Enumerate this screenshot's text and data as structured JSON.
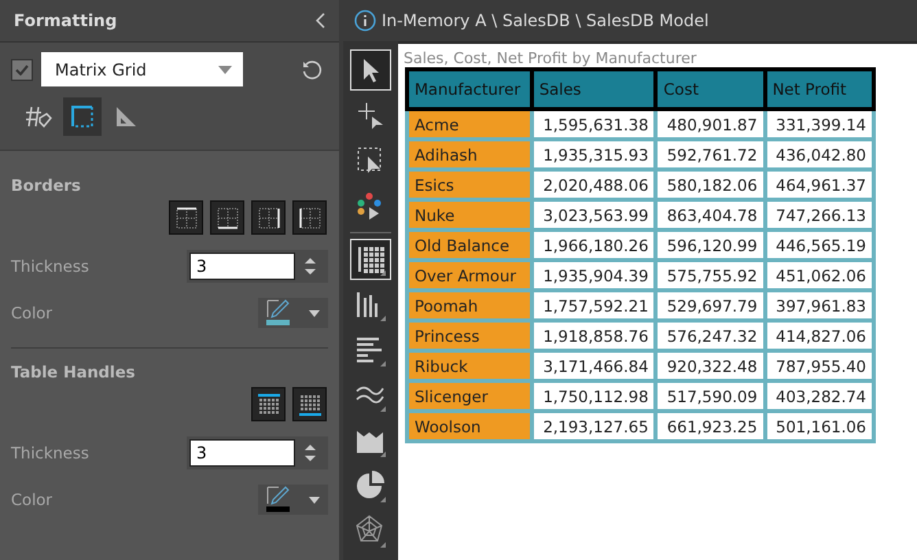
{
  "panel": {
    "title": "Formatting",
    "visual": {
      "checked": true,
      "value": "Matrix Grid"
    },
    "tabs": [
      {
        "kind": "format",
        "selected": false
      },
      {
        "kind": "borders",
        "selected": true
      },
      {
        "kind": "measure",
        "selected": false
      }
    ],
    "sections": [
      {
        "heading": "Borders",
        "options": [
          {
            "kind": "top",
            "selected": false
          },
          {
            "kind": "bottom",
            "selected": false
          },
          {
            "kind": "right",
            "selected": false
          },
          {
            "kind": "left",
            "selected": false
          }
        ],
        "thickness_label": "Thickness",
        "thickness": "3",
        "color_label": "Color",
        "color": "#5fb3c2"
      },
      {
        "heading": "Table Handles",
        "options": [
          {
            "kind": "top-handle",
            "selected": false
          },
          {
            "kind": "bottom-handle",
            "selected": false
          }
        ],
        "thickness_label": "Thickness",
        "thickness": "3",
        "color_label": "Color",
        "color": "#000000"
      }
    ]
  },
  "breadcrumb": "In-Memory A \\ SalesDB \\ SalesDB Model",
  "tools": [
    {
      "kind": "pointer",
      "selected": true
    },
    {
      "kind": "add",
      "selected": false
    },
    {
      "kind": "select",
      "selected": false
    },
    {
      "kind": "scatter",
      "selected": false
    },
    {
      "kind": "grid",
      "selected": true
    },
    {
      "kind": "columns",
      "selected": false
    },
    {
      "kind": "bars",
      "selected": false
    },
    {
      "kind": "lines",
      "selected": false
    },
    {
      "kind": "area",
      "selected": false
    },
    {
      "kind": "pie",
      "selected": false
    },
    {
      "kind": "radar",
      "selected": false
    }
  ],
  "table": {
    "title": "Sales, Cost, Net Profit by Manufacturer",
    "columns": [
      "Manufacturer",
      "Sales",
      "Cost",
      "Net Profit"
    ],
    "rows": [
      [
        "Acme",
        "1,595,631.38",
        "480,901.87",
        "331,399.14"
      ],
      [
        "Adihash",
        "1,935,315.93",
        "592,761.72",
        "436,042.80"
      ],
      [
        "Esics",
        "2,020,488.06",
        "580,182.06",
        "464,961.37"
      ],
      [
        "Nuke",
        "3,023,563.99",
        "863,404.78",
        "747,266.13"
      ],
      [
        "Old Balance",
        "1,966,180.26",
        "596,120.99",
        "446,565.19"
      ],
      [
        "Over Armour",
        "1,935,904.39",
        "575,755.92",
        "451,062.06"
      ],
      [
        "Poomah",
        "1,757,592.21",
        "529,697.79",
        "397,961.83"
      ],
      [
        "Princess",
        "1,918,858.76",
        "576,247.32",
        "414,827.06"
      ],
      [
        "Ribuck",
        "3,171,466.84",
        "920,322.48",
        "787,955.40"
      ],
      [
        "Slicenger",
        "1,750,112.98",
        "517,590.09",
        "403,282.74"
      ],
      [
        "Woolson",
        "2,193,127.65",
        "661,923.25",
        "501,161.06"
      ]
    ]
  }
}
